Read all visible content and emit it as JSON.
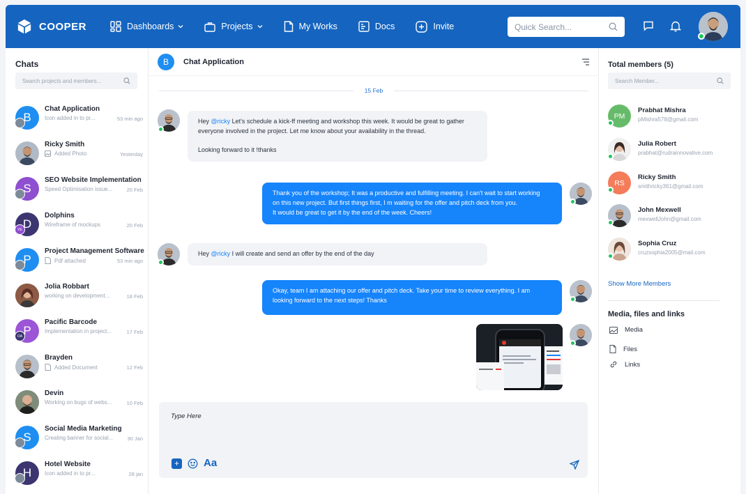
{
  "brand": {
    "name": "COOPER"
  },
  "nav": {
    "dashboards": "Dashboards",
    "projects": "Projects",
    "my_works": "My Works",
    "docs": "Docs",
    "invite": "Invite"
  },
  "quick_search": {
    "placeholder": "Quick Search..."
  },
  "chats": {
    "title": "Chats",
    "search_placeholder": "Search projects and members...",
    "items": [
      {
        "name": "Chat Application",
        "sub": "Icon added in to pr...",
        "time": "53 min ago"
      },
      {
        "name": "Ricky Smith",
        "sub": "Added Photo",
        "time": "Yesterday"
      },
      {
        "name": "SEO Website Implementation",
        "sub": "Speed Optimisation issue...",
        "time": "20 Feb"
      },
      {
        "name": "Dolphins",
        "sub": "Wireframe of mockups",
        "time": "20 Feb",
        "mini": "VE"
      },
      {
        "name": "Project Management Software",
        "sub": "Pdf attached",
        "time": "53 min ago"
      },
      {
        "name": "Jolia Robbart",
        "sub": "working on development...",
        "time": "18 Feb"
      },
      {
        "name": "Pacific Barcode",
        "sub": "Implementation in project...",
        "time": "17 Feb",
        "mini": "OA"
      },
      {
        "name": "Brayden",
        "sub": "Added Document",
        "time": "12 Feb"
      },
      {
        "name": "Devin",
        "sub": "Working on bugs of webs...",
        "time": "10 Feb"
      },
      {
        "name": "Social Media Marketing",
        "sub": "Creating banner for social...",
        "time": "30 Jan"
      },
      {
        "name": "Hotel Website",
        "sub": "Icon added in to pr...",
        "time": "28 jan"
      }
    ]
  },
  "conversation": {
    "badge": "B",
    "title": "Chat Application",
    "date": "15 Feb",
    "messages": [
      {
        "pre": "Hey ",
        "mention": "@ricky",
        "line1": " Let's schedule a kick-ff meeting and workshop this week. It would be great to gather",
        "line2": "everyone involved in the project. Let me know about your availability in the thread.",
        "line3": "Looking forward to it !thanks"
      },
      {
        "line1": "Thank you of the workshop; It was a productive and fulfilling meeting. I can't wait to start working",
        "line2": "on this new project. But first things first, I m waiting for the offer and pitch deck from you.",
        "line3": "It would be great to get it by the end of the week. Cheers!"
      },
      {
        "pre": "Hey ",
        "mention": "@ricky",
        "line1": " I will create and send an offer by the end of the day"
      },
      {
        "line1": "Okay, team I am attaching our offer and pitch deck. Take your time to review everything. I am",
        "line2": "looking forward to the next steps! Thanks"
      }
    ],
    "composer": {
      "placeholder": "Type Here",
      "format_label": "Aa"
    }
  },
  "members": {
    "title": "Total members (5)",
    "search_placeholder": "Search Member...",
    "list": [
      {
        "initials": "PM",
        "name": "Prabhat Mishra",
        "email": "pMishra578@gmail.com"
      },
      {
        "initials": "",
        "name": "Julia Robert",
        "email": "prabhat@rudrainnovative.com"
      },
      {
        "initials": "RS",
        "name": "Ricky Smith",
        "email": "smithricky361@gmail.com"
      },
      {
        "initials": "",
        "name": "John Mexwell",
        "email": "mexwellJohn@gmail.com"
      },
      {
        "initials": "",
        "name": "Sophia Cruz",
        "email": "cruzsophia2005@mail.com"
      }
    ],
    "show_more": "Show More Members"
  },
  "media": {
    "title": "Media, files and links",
    "items": [
      "Media",
      "Files",
      "Links"
    ]
  },
  "colors": {
    "primary": "#1565c0",
    "bubble_out": "#1684fb",
    "online": "#22c55e"
  }
}
